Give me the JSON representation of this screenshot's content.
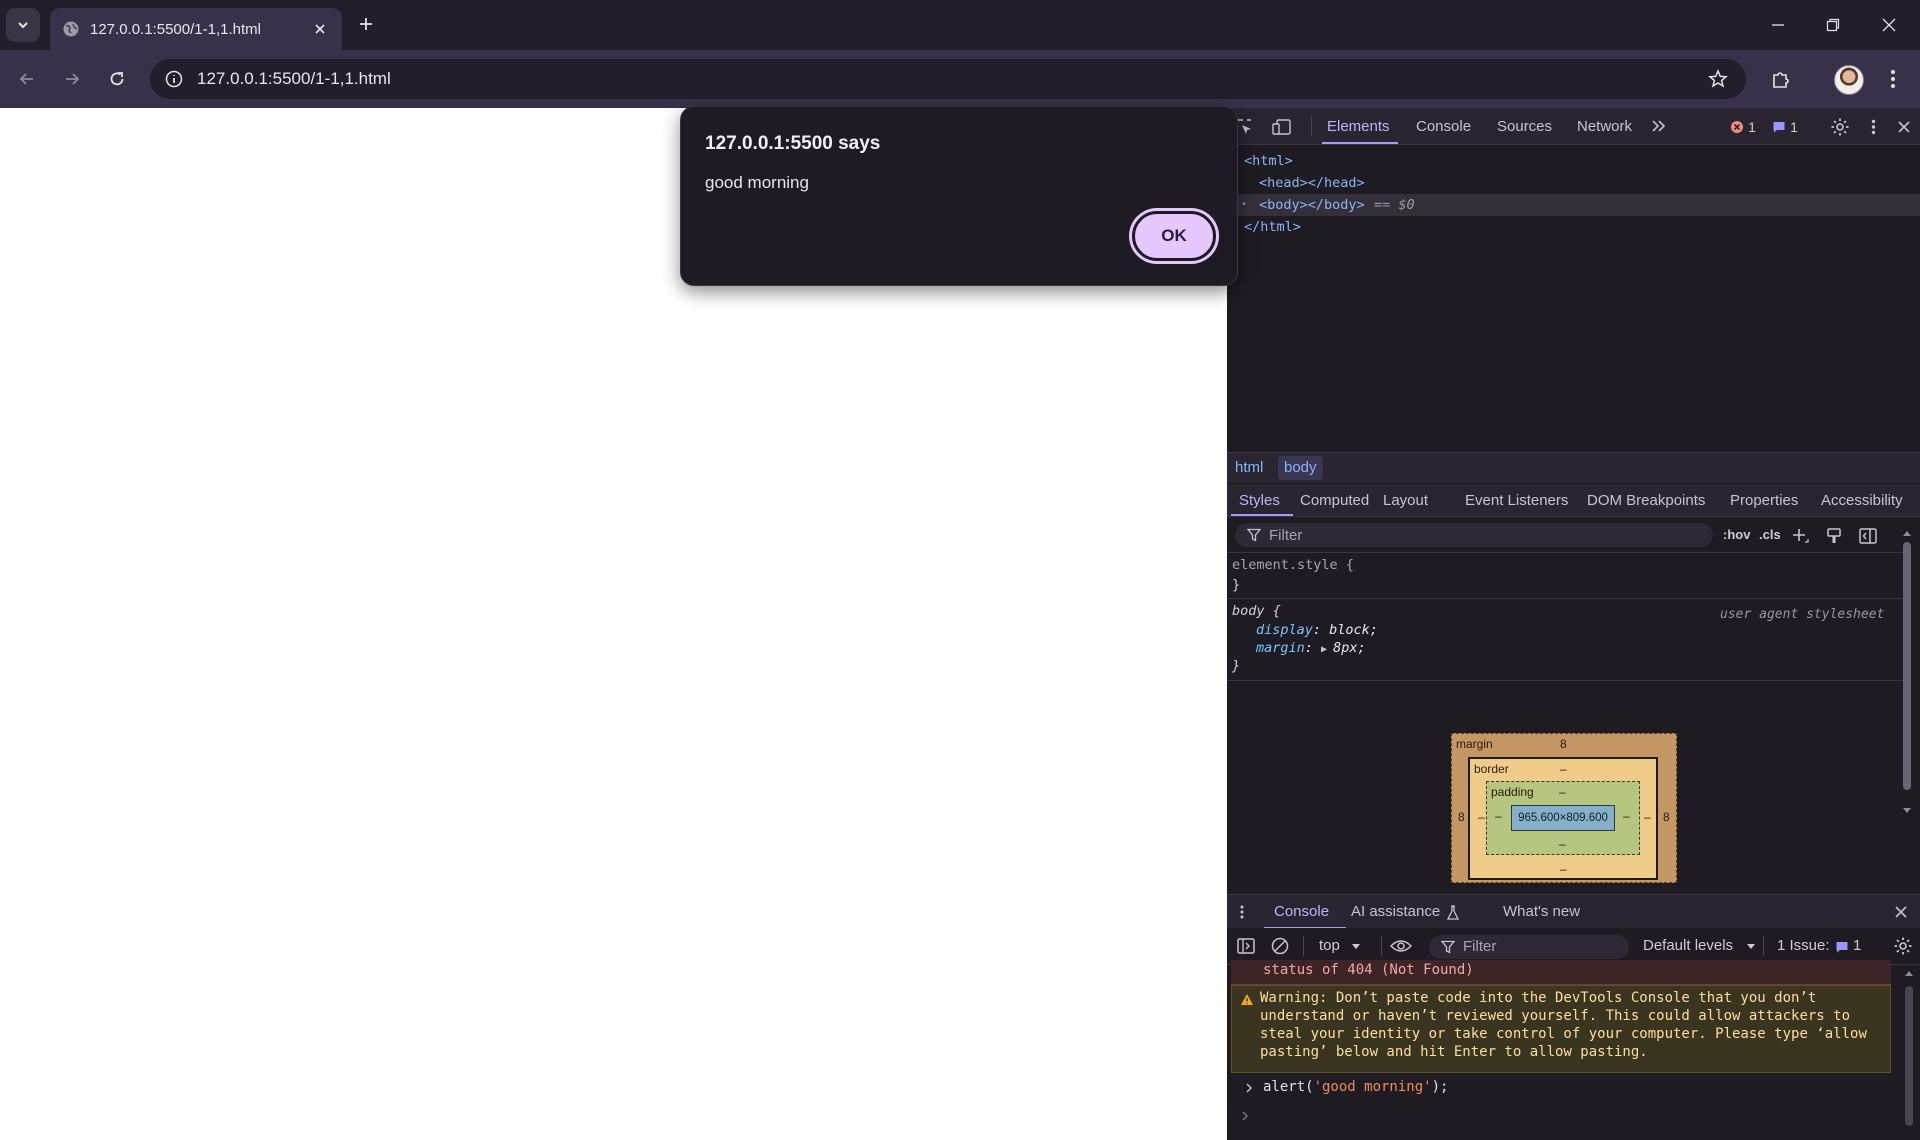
{
  "tab": {
    "title": "127.0.0.1:5500/1-1,1.html"
  },
  "address_bar": {
    "url": "127.0.0.1:5500/1-1,1.html"
  },
  "alert": {
    "title": "127.0.0.1:5500 says",
    "message": "good morning",
    "ok_label": "OK"
  },
  "devtools": {
    "tabs": [
      {
        "label": "Elements",
        "active": true
      },
      {
        "label": "Console"
      },
      {
        "label": "Sources"
      },
      {
        "label": "Network"
      }
    ],
    "error_count": "1",
    "message_count": "1",
    "dom": {
      "html_open": "<html>",
      "head": "<head></head>",
      "body": "<body></body>",
      "body_suffix": "== $0",
      "html_close": "</html>"
    },
    "breadcrumbs": [
      "html",
      "body"
    ],
    "styles_tabs": [
      "Styles",
      "Computed",
      "Layout",
      "Event Listeners",
      "DOM Breakpoints",
      "Properties",
      "Accessibility"
    ],
    "filter_placeholder": "Filter",
    "hov": ":hov",
    "cls": ".cls",
    "element_style": {
      "selector": "element.style {",
      "close": "}"
    },
    "body_rule": {
      "selector": "body {",
      "source": "user agent stylesheet",
      "props": [
        {
          "name": "display",
          "value": "block;"
        },
        {
          "name": "margin",
          "value": "8px;"
        }
      ],
      "close": "}"
    },
    "box_model": {
      "margin_label": "margin",
      "margin_top": "8",
      "margin_left": "8",
      "margin_right": "8",
      "margin_bottom": "8",
      "border_label": "border",
      "border_value": "–",
      "padding_label": "padding",
      "padding_value": "–",
      "content": "965.600×809.600"
    },
    "drawer_tabs": [
      {
        "label": "Console",
        "active": true
      },
      {
        "label": "AI assistance"
      },
      {
        "label": "What's new"
      }
    ],
    "console_toolbar": {
      "context": "top",
      "filter_placeholder": "Filter",
      "levels": "Default levels",
      "issues_label": "1 Issue:",
      "issues_count": "1"
    },
    "console_messages": {
      "error": "status of 404 (Not Found)",
      "warning_lines": [
        "Warning: Don’t paste code into the DevTools Console that you don’t",
        "understand or haven’t reviewed yourself. This could allow attackers to",
        "steal your identity or take control of your computer. Please type ‘allow",
        "pasting’ below and hit Enter to allow pasting."
      ],
      "command_prefix": "alert(",
      "command_string": "'good morning'",
      "command_suffix": ");"
    }
  },
  "colors": {
    "accent": "#a996ff",
    "ok_button": "#e6c8ff",
    "error": "#f28b82",
    "warning": "#ffdd9e"
  }
}
